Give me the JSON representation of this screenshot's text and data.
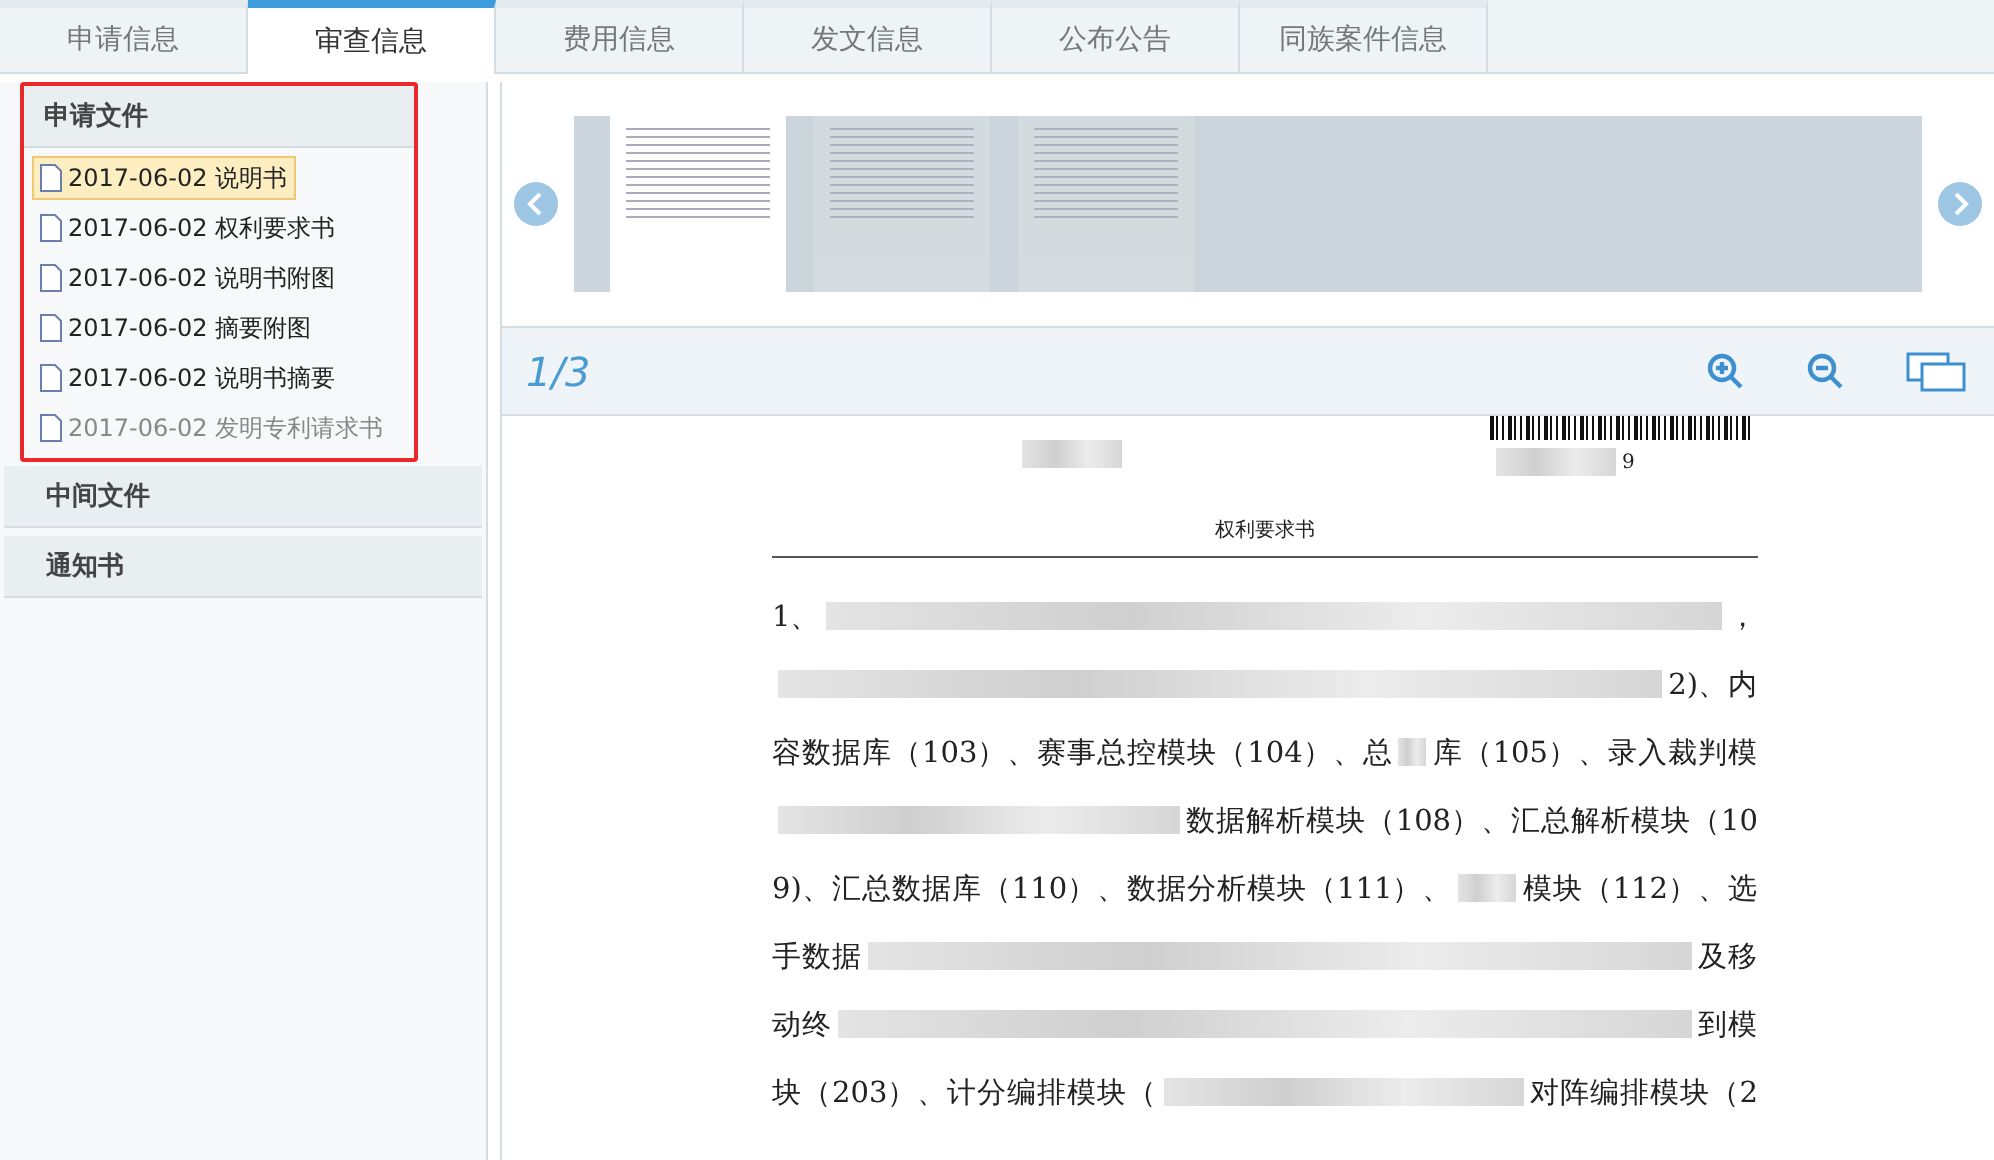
{
  "tabs": [
    {
      "label": "申请信息",
      "selected": false
    },
    {
      "label": "审查信息",
      "selected": true
    },
    {
      "label": "费用信息",
      "selected": false
    },
    {
      "label": "发文信息",
      "selected": false
    },
    {
      "label": "公布公告",
      "selected": false
    },
    {
      "label": "同族案件信息",
      "selected": false
    }
  ],
  "sidebar": {
    "sections": [
      {
        "title": "申请文件",
        "expanded": true,
        "highlighted": true,
        "items": [
          {
            "date": "2017-06-02",
            "name": "说明书",
            "selected": true,
            "disabled": false
          },
          {
            "date": "2017-06-02",
            "name": "权利要求书",
            "selected": false,
            "disabled": false
          },
          {
            "date": "2017-06-02",
            "name": "说明书附图",
            "selected": false,
            "disabled": false
          },
          {
            "date": "2017-06-02",
            "name": "摘要附图",
            "selected": false,
            "disabled": false
          },
          {
            "date": "2017-06-02",
            "name": "说明书摘要",
            "selected": false,
            "disabled": false
          },
          {
            "date": "2017-06-02",
            "name": "发明专利请求书",
            "selected": false,
            "disabled": true
          }
        ]
      },
      {
        "title": "中间文件",
        "expanded": false,
        "highlighted": false
      },
      {
        "title": "通知书",
        "expanded": false,
        "highlighted": false
      }
    ]
  },
  "viewer": {
    "thumbnails": [
      {
        "selected": true
      },
      {
        "selected": false
      },
      {
        "selected": false
      }
    ],
    "page_indicator": "1/3",
    "document": {
      "number_suffix": "9",
      "title": "权利要求书",
      "lines": [
        [
          {
            "kind": "text",
            "text": "1、"
          },
          {
            "kind": "blur"
          },
          {
            "kind": "text",
            "text": "，"
          }
        ],
        [
          {
            "kind": "blur"
          },
          {
            "kind": "text",
            "text": "2)、内"
          }
        ],
        [
          {
            "kind": "text",
            "text": "容数据库（103）、赛事总控模块（104）、总"
          },
          {
            "kind": "blur"
          },
          {
            "kind": "text",
            "text": "库（105）、录入裁判模"
          }
        ],
        [
          {
            "kind": "blur"
          },
          {
            "kind": "text",
            "text": "数据解析模块（108）、汇总解析模块（10"
          }
        ],
        [
          {
            "kind": "text",
            "text": "9)、汇总数据库（110）、数据分析模块（111）、"
          },
          {
            "kind": "blur"
          },
          {
            "kind": "text",
            "text": "模块（112）、选"
          }
        ],
        [
          {
            "kind": "text",
            "text": "手数据"
          },
          {
            "kind": "blur"
          },
          {
            "kind": "text",
            "text": "及移"
          }
        ],
        [
          {
            "kind": "text",
            "text": "动终"
          },
          {
            "kind": "blur"
          },
          {
            "kind": "text",
            "text": "到模"
          }
        ],
        [
          {
            "kind": "text",
            "text": "块（203）、计分编排模块（"
          },
          {
            "kind": "blur"
          },
          {
            "kind": "text",
            "text": "对阵编排模块（2"
          }
        ]
      ]
    }
  }
}
